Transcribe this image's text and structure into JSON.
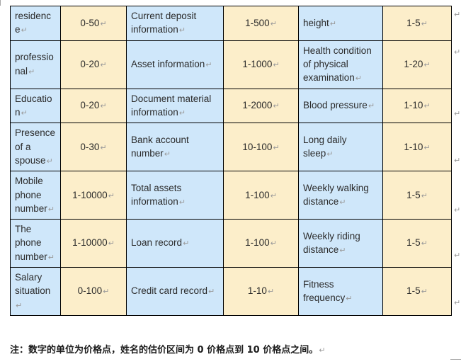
{
  "document": {
    "paragraph_mark": "↵",
    "table": {
      "columns": 6,
      "rows": [
        {
          "label_a": "residence",
          "value_a": "0-50",
          "label_b": "Current deposit information",
          "value_b": "1-500",
          "label_c": "height",
          "value_c": "1-5"
        },
        {
          "label_a": "professional",
          "value_a": "0-20",
          "label_b": "Asset information",
          "value_b": "1-1000",
          "label_c": "Health condition of physical examination",
          "value_c": "1-20"
        },
        {
          "label_a": "Education",
          "value_a": "0-20",
          "label_b": "Document material information",
          "value_b": "1-2000",
          "label_c": "Blood pressure",
          "value_c": "1-10"
        },
        {
          "label_a": "Presence of a spouse",
          "value_a": "0-30",
          "label_b": "Bank account number",
          "value_b": "10-100",
          "label_c": "Long daily sleep",
          "value_c": "1-10"
        },
        {
          "label_a": "Mobile phone number",
          "value_a": "1-10000",
          "label_b": "Total assets information",
          "value_b": "1-100",
          "label_c": "Weekly walking distance",
          "value_c": "1-5"
        },
        {
          "label_a": "The phone number",
          "value_a": "1-10000",
          "label_b": "Loan record",
          "value_b": "1-100",
          "label_c": "Weekly riding distance",
          "value_c": "1-5"
        },
        {
          "label_a": "Salary situation",
          "value_a": "0-100",
          "label_b": "Credit card record",
          "value_b": "1-10",
          "label_c": "Fitness frequency",
          "value_c": "1-5"
        }
      ]
    },
    "footer_note": "注：数字的单位为价格点，姓名的估价区间为 0 价格点到 10 价格点之间。",
    "outside_paragraph_marks": [
      "↵",
      "↵",
      "↵",
      "↵",
      "↵",
      "↵",
      "↵"
    ]
  },
  "colors": {
    "label_cell_fill": "#cfe7fa",
    "value_cell_fill": "#fceeca",
    "border": "#000000",
    "paragraph_mark": "#9a9a9a",
    "margin_mark": "#a6a6a6"
  }
}
